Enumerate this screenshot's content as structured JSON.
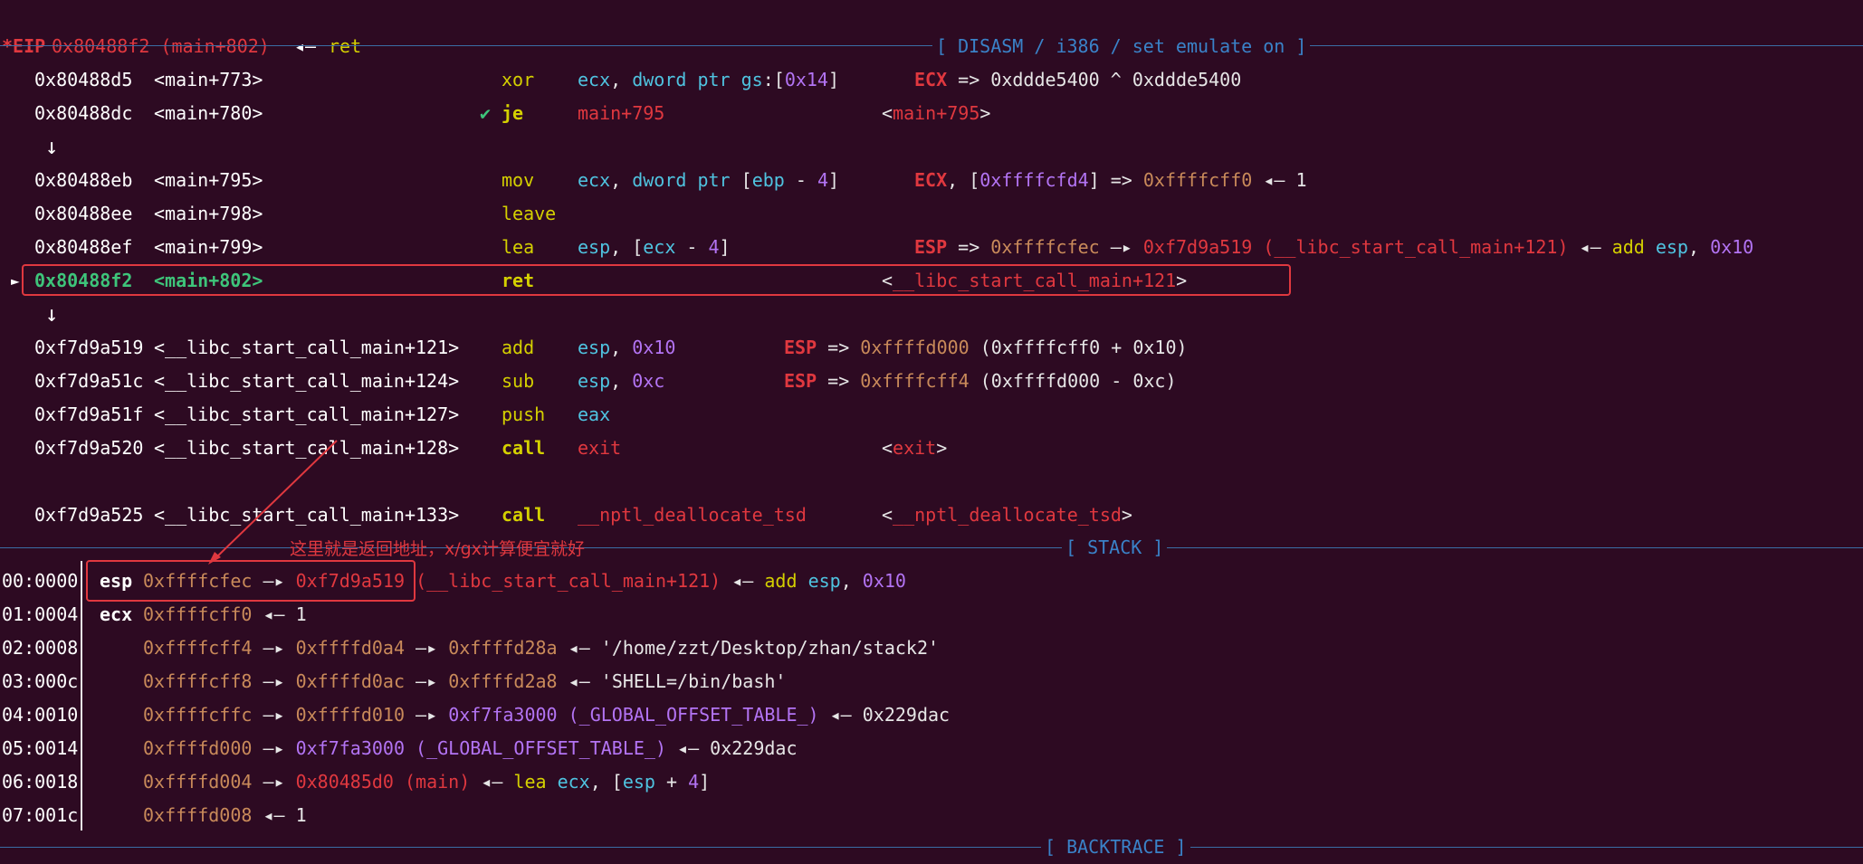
{
  "registers": {
    "eip_name": "*EIP",
    "eip_value": "0x80488f2 (main+802)",
    "eip_arrow": "◂—",
    "eip_instr": "ret"
  },
  "disasm": {
    "header": "[ DISASM / i386 / set emulate on ]",
    "rows": [
      {
        "addr": "0x80488d5",
        "sym": "<main+773>",
        "mn": "xor",
        "ops": "ecx, dword ptr gs:[0x14]",
        "comment": "ECX => 0xddde5400 ^ 0xddde5400"
      },
      {
        "addr": "0x80488dc",
        "sym": "<main+780>",
        "check": "✔",
        "mn": "je",
        "ops": "main+795",
        "target": "<main+795>"
      },
      {
        "arrow": "↓"
      },
      {
        "addr": "0x80488eb",
        "sym": "<main+795>",
        "mn": "mov",
        "ops": "ecx, dword ptr [ebp - 4]",
        "comment": "ECX, [0xffffcfd4] => 0xffffcff0 ◂— 1"
      },
      {
        "addr": "0x80488ee",
        "sym": "<main+798>",
        "mn": "leave"
      },
      {
        "addr": "0x80488ef",
        "sym": "<main+799>",
        "mn": "lea",
        "ops": "esp, [ecx - 4]",
        "comment": "ESP => 0xffffcfec —▸ 0xf7d9a519 (__libc_start_call_main+121) ◂— add esp, 0x10"
      },
      {
        "current": true,
        "marker": "►",
        "addr": "0x80488f2",
        "sym": "<main+802>",
        "mn": "ret",
        "target": "<__libc_start_call_main+121>"
      },
      {
        "arrow": "↓"
      },
      {
        "addr": "0xf7d9a519",
        "sym": "<__libc_start_call_main+121>",
        "mn": "add",
        "ops": "esp, 0x10",
        "comment": "ESP => 0xffffd000 (0xffffcff0 + 0x10)"
      },
      {
        "addr": "0xf7d9a51c",
        "sym": "<__libc_start_call_main+124>",
        "mn": "sub",
        "ops": "esp, 0xc",
        "comment": "ESP => 0xffffcff4 (0xffffd000 - 0xc)"
      },
      {
        "addr": "0xf7d9a51f",
        "sym": "<__libc_start_call_main+127>",
        "mn": "push",
        "ops": "eax"
      },
      {
        "addr": "0xf7d9a520",
        "sym": "<__libc_start_call_main+128>",
        "mn": "call",
        "ops": "exit",
        "target": "<exit>"
      },
      {
        "addr": "0xf7d9a525",
        "sym": "<__libc_start_call_main+133>",
        "mn": "call",
        "ops": "__nptl_deallocate_tsd",
        "target": "<__nptl_deallocate_tsd>"
      }
    ]
  },
  "annotation": "这里就是返回地址，x/gx计算便宜就好",
  "stack": {
    "header": "[ STACK ]",
    "rows": [
      {
        "idx": "00:0000",
        "reg": "esp",
        "chain": "0xffffcfec —▸ 0xf7d9a519 (__libc_start_call_main+121) ◂— add esp, 0x10"
      },
      {
        "idx": "01:0004",
        "reg": "ecx",
        "chain": "0xffffcff0 ◂— 1"
      },
      {
        "idx": "02:0008",
        "reg": "",
        "chain": "0xffffcff4 —▸ 0xffffd0a4 —▸ 0xffffd28a ◂— '/home/zzt/Desktop/zhan/stack2'"
      },
      {
        "idx": "03:000c",
        "reg": "",
        "chain": "0xffffcff8 —▸ 0xffffd0ac —▸ 0xffffd2a8 ◂— 'SHELL=/bin/bash'"
      },
      {
        "idx": "04:0010",
        "reg": "",
        "chain": "0xffffcffc —▸ 0xffffd010 —▸ 0xf7fa3000 (_GLOBAL_OFFSET_TABLE_) ◂— 0x229dac"
      },
      {
        "idx": "05:0014",
        "reg": "",
        "chain": "0xffffd000 —▸ 0xf7fa3000 (_GLOBAL_OFFSET_TABLE_) ◂— 0x229dac"
      },
      {
        "idx": "06:0018",
        "reg": "",
        "chain": "0xffffd004 —▸ 0x80485d0 (main) ◂— lea ecx, [esp + 4]"
      },
      {
        "idx": "07:001c",
        "reg": "",
        "chain": "0xffffd008 ◂— 1"
      }
    ]
  },
  "backtrace": {
    "header": "[ BACKTRACE ]"
  },
  "colors": {
    "background": "#2d0a22",
    "separator": "#3a6ea5",
    "highlight": "#e0383f"
  }
}
